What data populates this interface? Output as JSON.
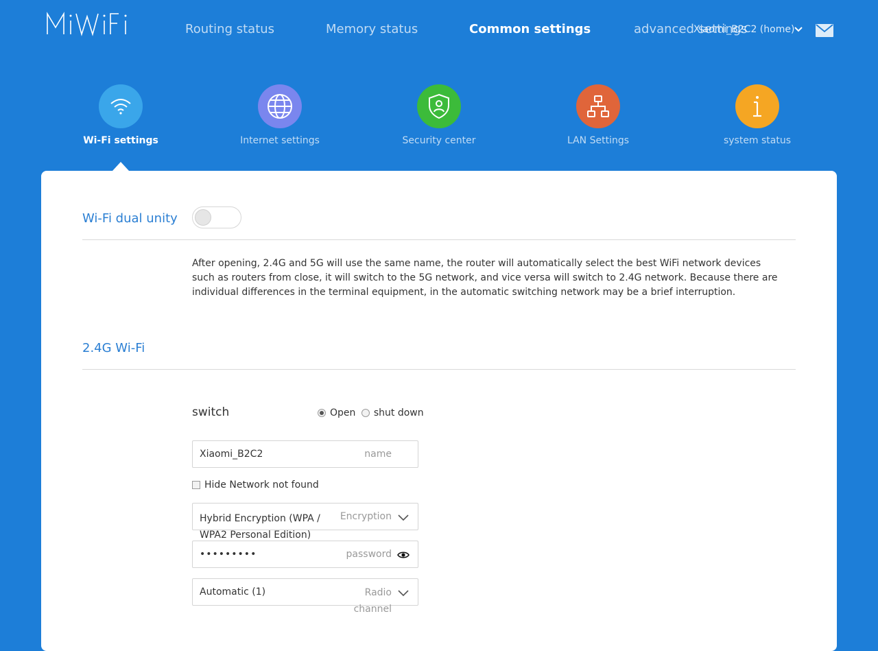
{
  "header": {
    "logo_text": "MiWiFi",
    "nav": [
      "Routing status",
      "Memory status",
      "Common settings",
      "advanced settings"
    ],
    "active_nav": "Common settings",
    "router_name": "Xiaomi_B2C2 (home)"
  },
  "tabs": [
    {
      "label": "Wi-Fi settings",
      "icon": "wifi-icon",
      "color": "#3aa6ea"
    },
    {
      "label": "Internet settings",
      "icon": "globe-icon",
      "color": "#7a86ee"
    },
    {
      "label": "Security center",
      "icon": "shield-icon",
      "color": "#3cbb3a"
    },
    {
      "label": "LAN Settings",
      "icon": "network-icon",
      "color": "#e0653a"
    },
    {
      "label": "system status",
      "icon": "info-icon",
      "color": "#f5a623"
    }
  ],
  "dual_unity": {
    "title": "Wi-Fi dual unity",
    "enabled": false,
    "description": "After opening, 2.4G and 5G will use the same name, the router will automatically select the best WiFi network devices such as routers from close, it will switch to the 5G network, and vice versa will switch to 2.4G network. Because there are individual differences in the terminal equipment, in the automatic switching network may be a brief interruption."
  },
  "wifi24": {
    "title": "2.4G Wi-Fi",
    "switch_label": "switch",
    "options": [
      "Open",
      "shut down"
    ],
    "selected": "Open",
    "name_value": "Xiaomi_B2C2",
    "name_placeholder": "name",
    "hide_network_label": "Hide Network not found",
    "hide_network_checked": false,
    "encryption_value": "Hybrid Encryption (WPA / WPA2 Personal Edition)",
    "encryption_placeholder": "Encryption",
    "password_value": "•••••••••",
    "password_placeholder": "password",
    "channel_value": "Automatic (1)",
    "channel_placeholder": "Radio channel"
  },
  "colors": {
    "background": "#1d7ed8",
    "accent": "#2b7fd3"
  }
}
